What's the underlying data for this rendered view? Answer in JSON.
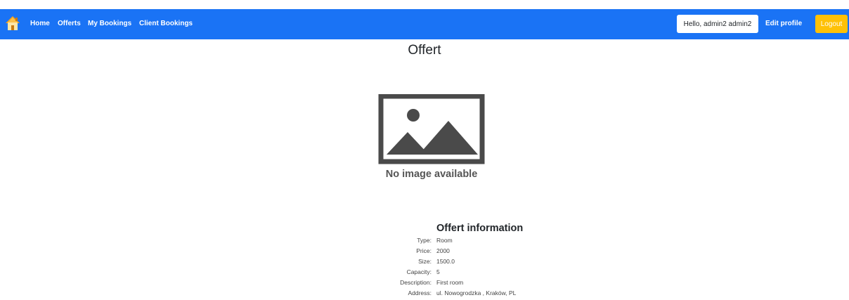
{
  "navbar": {
    "logo_icon": "house-icon",
    "links": [
      "Home",
      "Offerts",
      "My Bookings",
      "Client Bookings"
    ],
    "greeting": "Hello, admin2 admin2",
    "edit_profile": "Edit profile",
    "logout": "Logout",
    "colors": {
      "bar": "#1a73f5",
      "logout": "#ffc107"
    }
  },
  "page": {
    "title": "Offert"
  },
  "image": {
    "icon": "image-placeholder-icon",
    "caption": "No image available"
  },
  "info": {
    "title": "Offert information",
    "rows": [
      {
        "label": "Type:",
        "value": "Room"
      },
      {
        "label": "Price:",
        "value": "2000"
      },
      {
        "label": "Size:",
        "value": "1500.0"
      },
      {
        "label": "Capacity:",
        "value": "5"
      },
      {
        "label": "Description:",
        "value": "First room"
      },
      {
        "label": "Address:",
        "value": "ul. Nowogrodzka , Kraków, PL"
      }
    ]
  }
}
